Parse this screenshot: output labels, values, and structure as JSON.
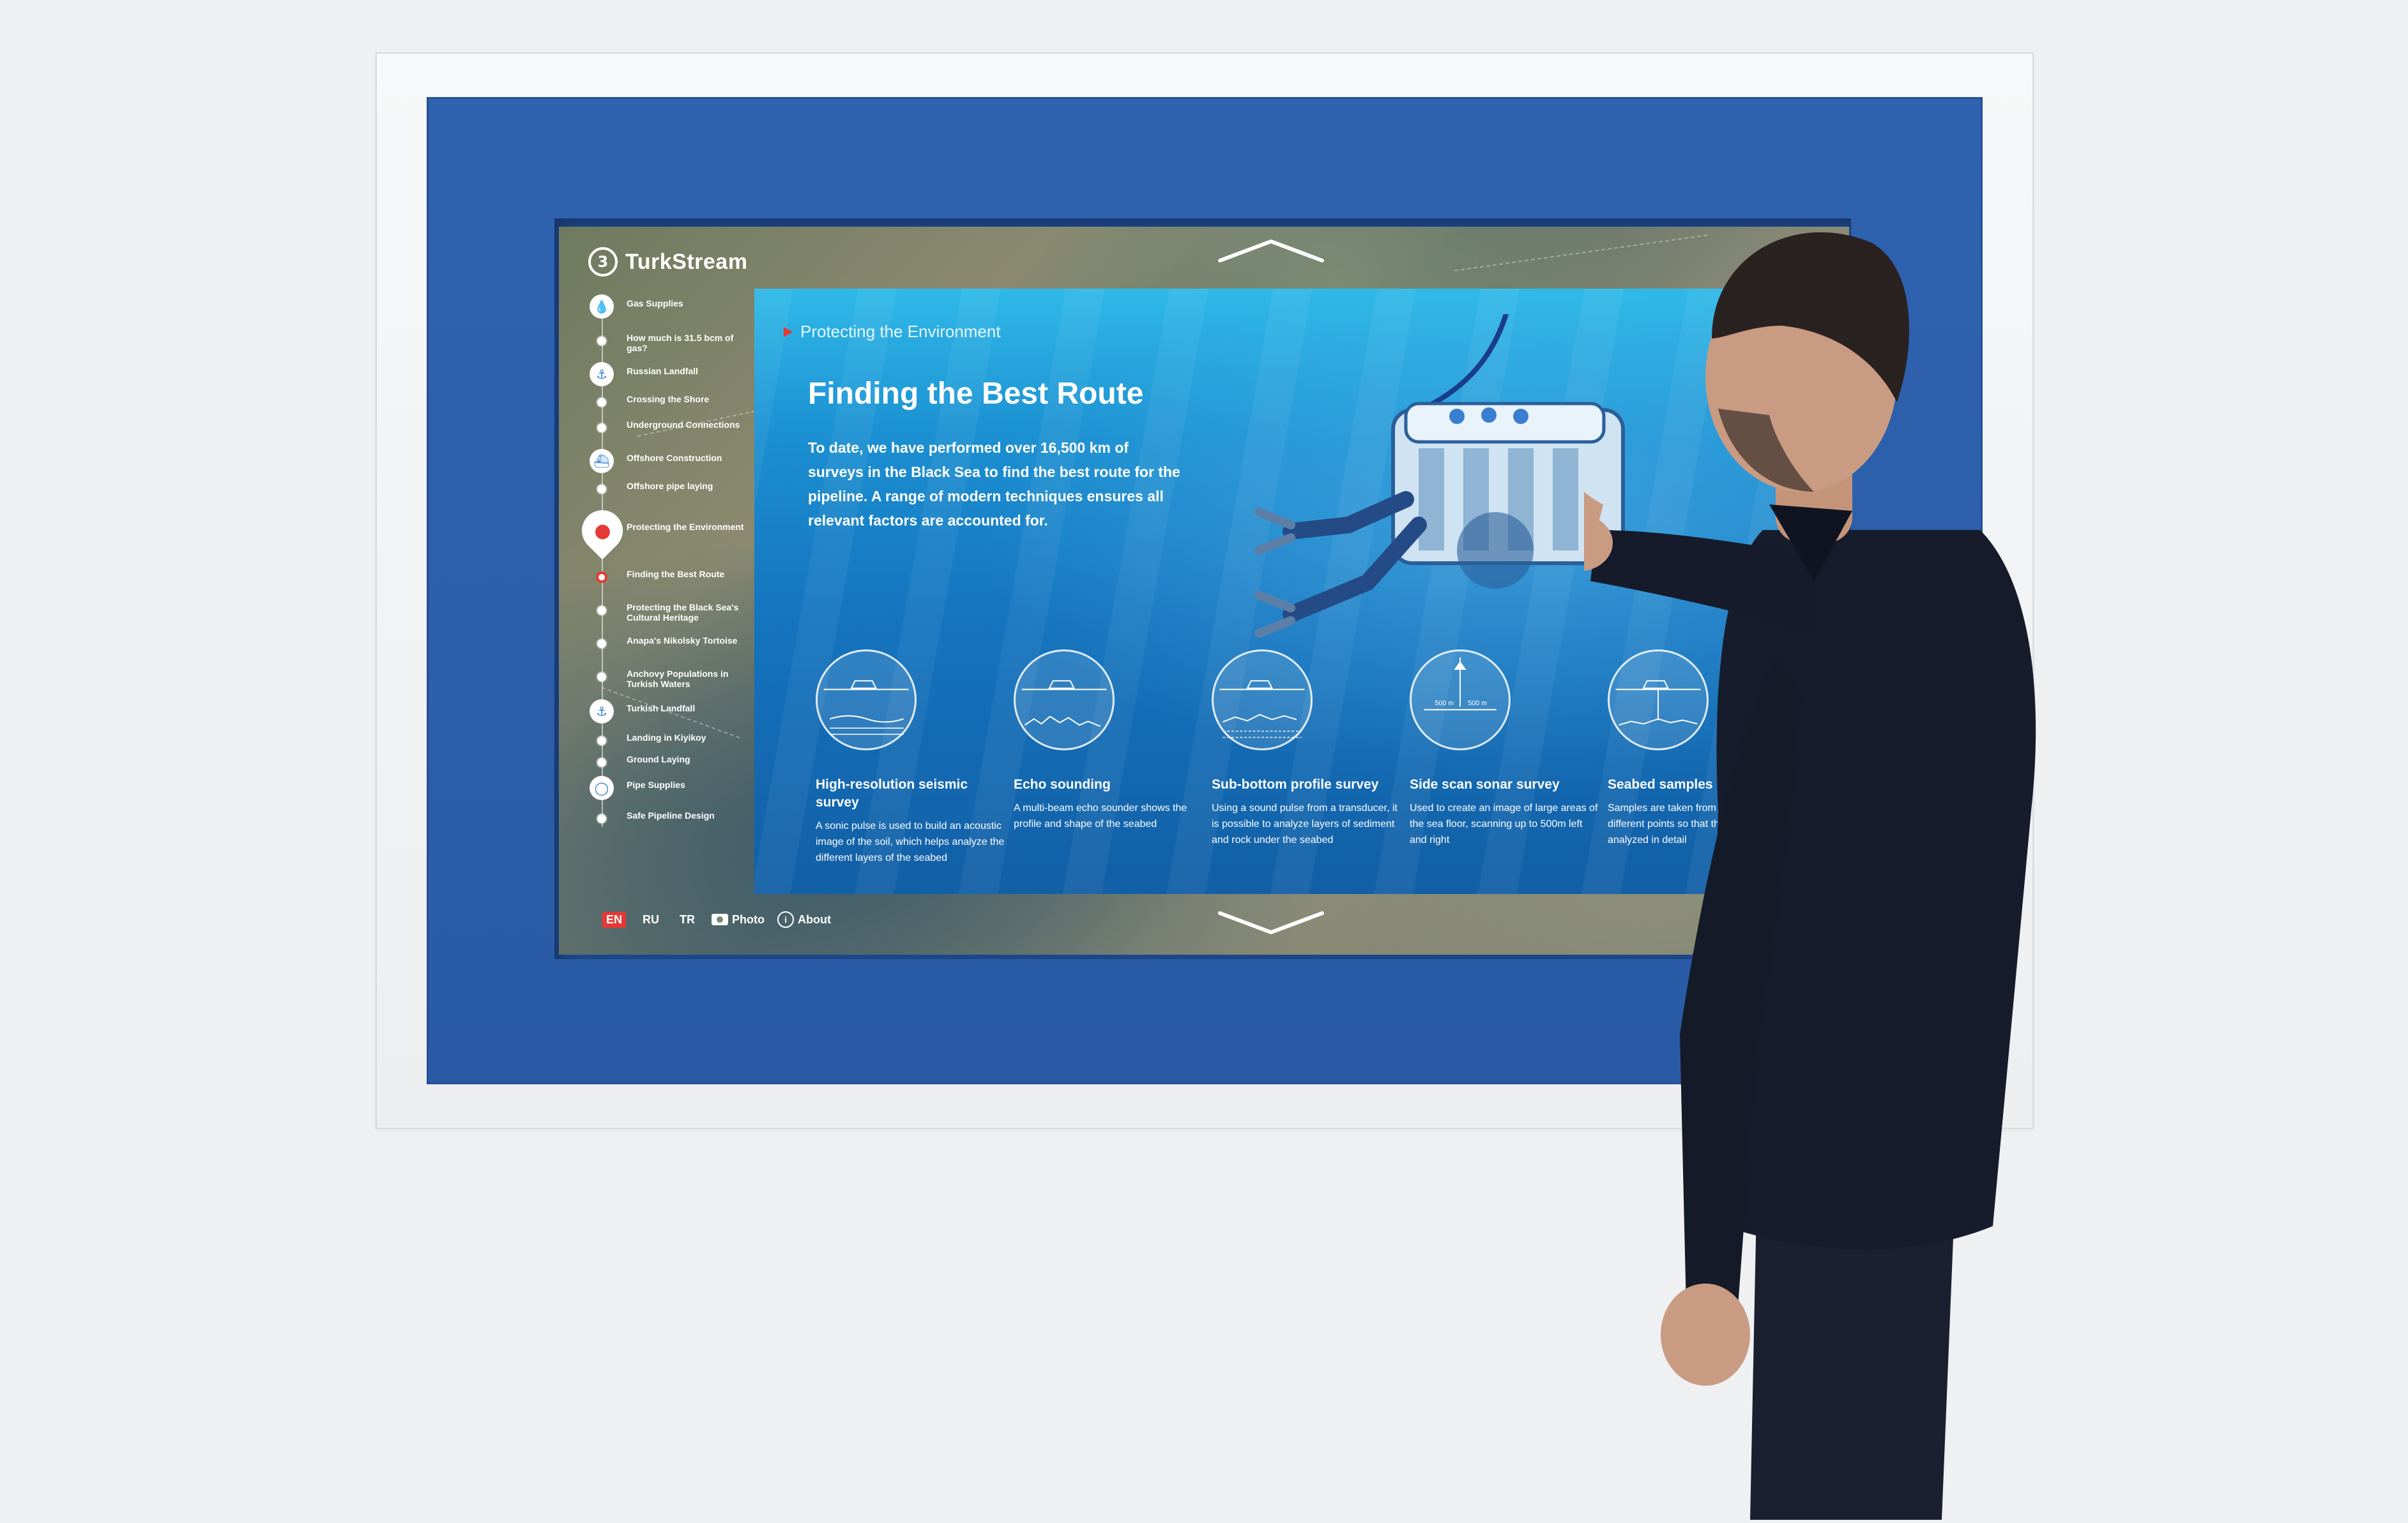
{
  "sidebar": {
    "logo_mark": "3",
    "logo_text": "TurkStream",
    "items": [
      {
        "label": "Gas Supplies",
        "kind": "section",
        "icon": "gas-drop-icon"
      },
      {
        "label": "How much is 31.5 bcm of gas?",
        "kind": "sub"
      },
      {
        "label": "Russian Landfall",
        "kind": "section",
        "icon": "landfall-icon"
      },
      {
        "label": "Crossing the Shore",
        "kind": "sub"
      },
      {
        "label": "Underground Connections",
        "kind": "sub"
      },
      {
        "label": "Offshore Construction",
        "kind": "section",
        "icon": "ship-icon"
      },
      {
        "label": "Offshore pipe laying",
        "kind": "sub"
      },
      {
        "label": "Protecting the Environment",
        "kind": "pin",
        "icon": "fish-icon"
      },
      {
        "label": "Finding the Best Route",
        "kind": "sub-active"
      },
      {
        "label": "Protecting the Black Sea's Cultural Heritage",
        "kind": "sub"
      },
      {
        "label": "Anapa's Nikolsky Tortoise",
        "kind": "sub"
      },
      {
        "label": "Anchovy Populations in Turkish Waters",
        "kind": "sub"
      },
      {
        "label": "Turkish Landfall",
        "kind": "section",
        "icon": "landfall-icon"
      },
      {
        "label": "Landing in Kiyikoy",
        "kind": "sub"
      },
      {
        "label": "Ground Laying",
        "kind": "sub"
      },
      {
        "label": "Pipe Supplies",
        "kind": "section",
        "icon": "pipe-icon"
      },
      {
        "label": "Safe Pipeline Design",
        "kind": "sub"
      }
    ]
  },
  "bottom_bar": {
    "languages": [
      "EN",
      "RU",
      "TR"
    ],
    "active_language": "EN",
    "photo_label": "Photo",
    "about_label": "About"
  },
  "content": {
    "breadcrumb": "Protecting the Environment",
    "title": "Finding the Best Route",
    "intro": "To date, we have performed over 16,500 km of surveys in the Black Sea to find the best route for the pipeline. A range of modern techniques ensures all relevant factors are accounted for.",
    "methods": [
      {
        "name": "High-resolution seismic survey",
        "desc": "A sonic pulse is used to build an acoustic image of the soil, which helps analyze the different layers of the seabed"
      },
      {
        "name": "Echo sounding",
        "desc": "A multi-beam echo sounder shows the profile and shape of the seabed"
      },
      {
        "name": "Sub-bottom profile survey",
        "desc": "Using a sound pulse from a transducer, it is possible to analyze layers of sediment and rock under the seabed"
      },
      {
        "name": "Side scan sonar survey",
        "desc": "Used to create an image of large areas of the sea floor, scanning up to 500m left and right"
      },
      {
        "name": "Seabed samples",
        "desc": "Samples are taken from the seabed at different points so that the soil can be analyzed in detail"
      }
    ],
    "sonar_label_left": "500 m",
    "sonar_label_right": "500 m"
  },
  "colors": {
    "accent_red": "#e53935",
    "bezel_blue": "#2f63b0",
    "panel_blue": "#1b8fd1"
  }
}
